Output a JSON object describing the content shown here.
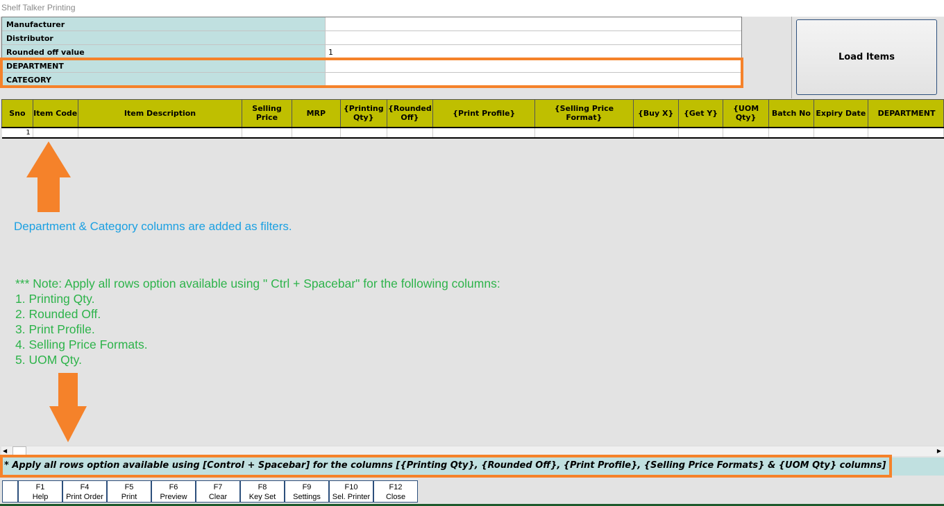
{
  "window": {
    "title": "Shelf Talker Printing"
  },
  "filters": [
    {
      "label": "Manufacturer",
      "value": ""
    },
    {
      "label": "Distributor",
      "value": ""
    },
    {
      "label": "Rounded off value",
      "value": "1"
    },
    {
      "label": "DEPARTMENT",
      "value": ""
    },
    {
      "label": "CATEGORY",
      "value": ""
    }
  ],
  "load_button": "Load Items",
  "grid": {
    "columns": [
      "Sno",
      "Item Code",
      "Item Description",
      "Selling Price",
      "MRP",
      "{Printing Qty}",
      "{Rounded Off}",
      "{Print Profile}",
      "{Selling Price Format}",
      "{Buy X}",
      "{Get Y}",
      "{UOM Qty}",
      "Batch No",
      "Expiry Date",
      "DEPARTMENT"
    ],
    "rows": [
      [
        "1",
        "",
        "",
        "",
        "",
        "",
        "",
        "",
        "",
        "",
        "",
        "",
        "",
        "",
        ""
      ]
    ]
  },
  "annotations": {
    "blue": "Department & Category columns are added as filters.",
    "green": [
      "*** Note: Apply all rows option available using \" Ctrl + Spacebar\" for the following columns:",
      "1. Printing Qty.",
      "2. Rounded Off.",
      "3. Print Profile.",
      "4. Selling Price Formats.",
      "5. UOM Qty."
    ],
    "color_orange": "#f5822a"
  },
  "note": "* Apply all rows option available using [Control + Spacebar] for the columns [{Printing Qty}, {Rounded Off}, {Print Profile}, {Selling Price Formats} & {UOM Qty} columns]",
  "fkeys": [
    {
      "key": "F1",
      "label": "Help"
    },
    {
      "key": "F4",
      "label": "Print Order"
    },
    {
      "key": "F5",
      "label": "Print"
    },
    {
      "key": "F6",
      "label": "Preview"
    },
    {
      "key": "F7",
      "label": "Clear"
    },
    {
      "key": "F8",
      "label": "Key Set"
    },
    {
      "key": "F9",
      "label": "Settings"
    },
    {
      "key": "F10",
      "label": "Sel. Printer"
    },
    {
      "key": "F12",
      "label": "Close"
    }
  ]
}
